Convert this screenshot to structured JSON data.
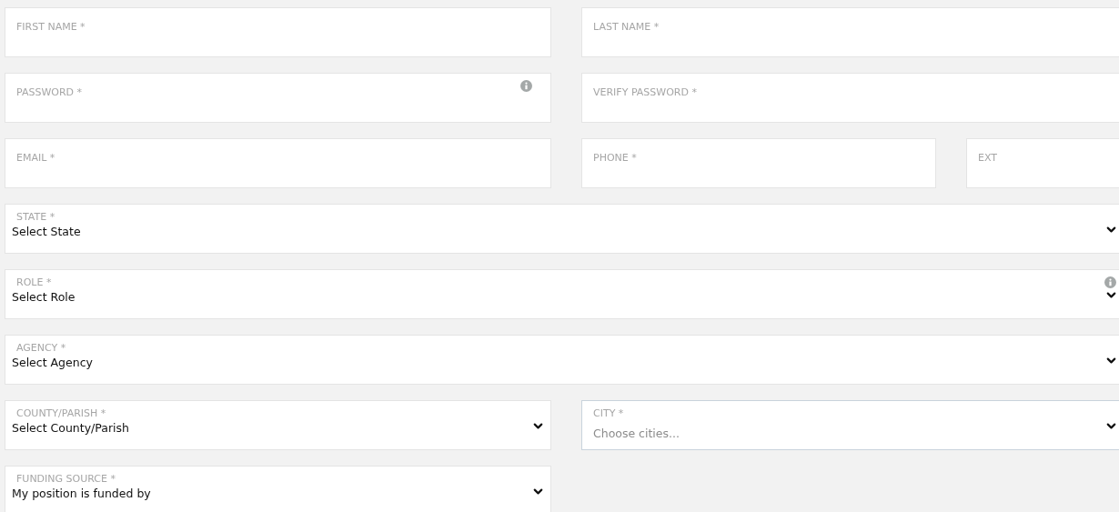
{
  "rows": [
    {
      "left": {
        "kind": "text",
        "label": "FIRST NAME *",
        "info": false
      },
      "right": [
        {
          "kind": "text",
          "label": "LAST NAME *",
          "info": false
        }
      ]
    },
    {
      "left": {
        "kind": "text",
        "label": "PASSWORD *",
        "info": true
      },
      "right": [
        {
          "kind": "text",
          "label": "VERIFY PASSWORD *",
          "info": false
        }
      ]
    },
    {
      "left": {
        "kind": "text",
        "label": "EMAIL *",
        "info": false
      },
      "right": [
        {
          "kind": "text",
          "label": "PHONE *",
          "info": false
        },
        {
          "kind": "text",
          "label": "EXT",
          "info": false
        }
      ]
    },
    {
      "full": {
        "kind": "select",
        "label": "STATE *",
        "value": "Select State",
        "info": false
      }
    },
    {
      "full": {
        "kind": "select",
        "label": "ROLE *",
        "value": "Select Role",
        "info": true
      }
    },
    {
      "full": {
        "kind": "select",
        "label": "AGENCY *",
        "value": "Select Agency",
        "info": false
      }
    },
    {
      "left": {
        "kind": "select",
        "label": "COUNTY/PARISH *",
        "value": "Select County/Parish",
        "info": false
      },
      "right": [
        {
          "kind": "multiselect",
          "label": "CITY *",
          "placeholder": "Choose cities...",
          "info": false,
          "focused": true
        }
      ]
    },
    {
      "left": {
        "kind": "select",
        "label": "FUNDING SOURCE *",
        "value": "My position is funded by",
        "info": false
      }
    }
  ]
}
